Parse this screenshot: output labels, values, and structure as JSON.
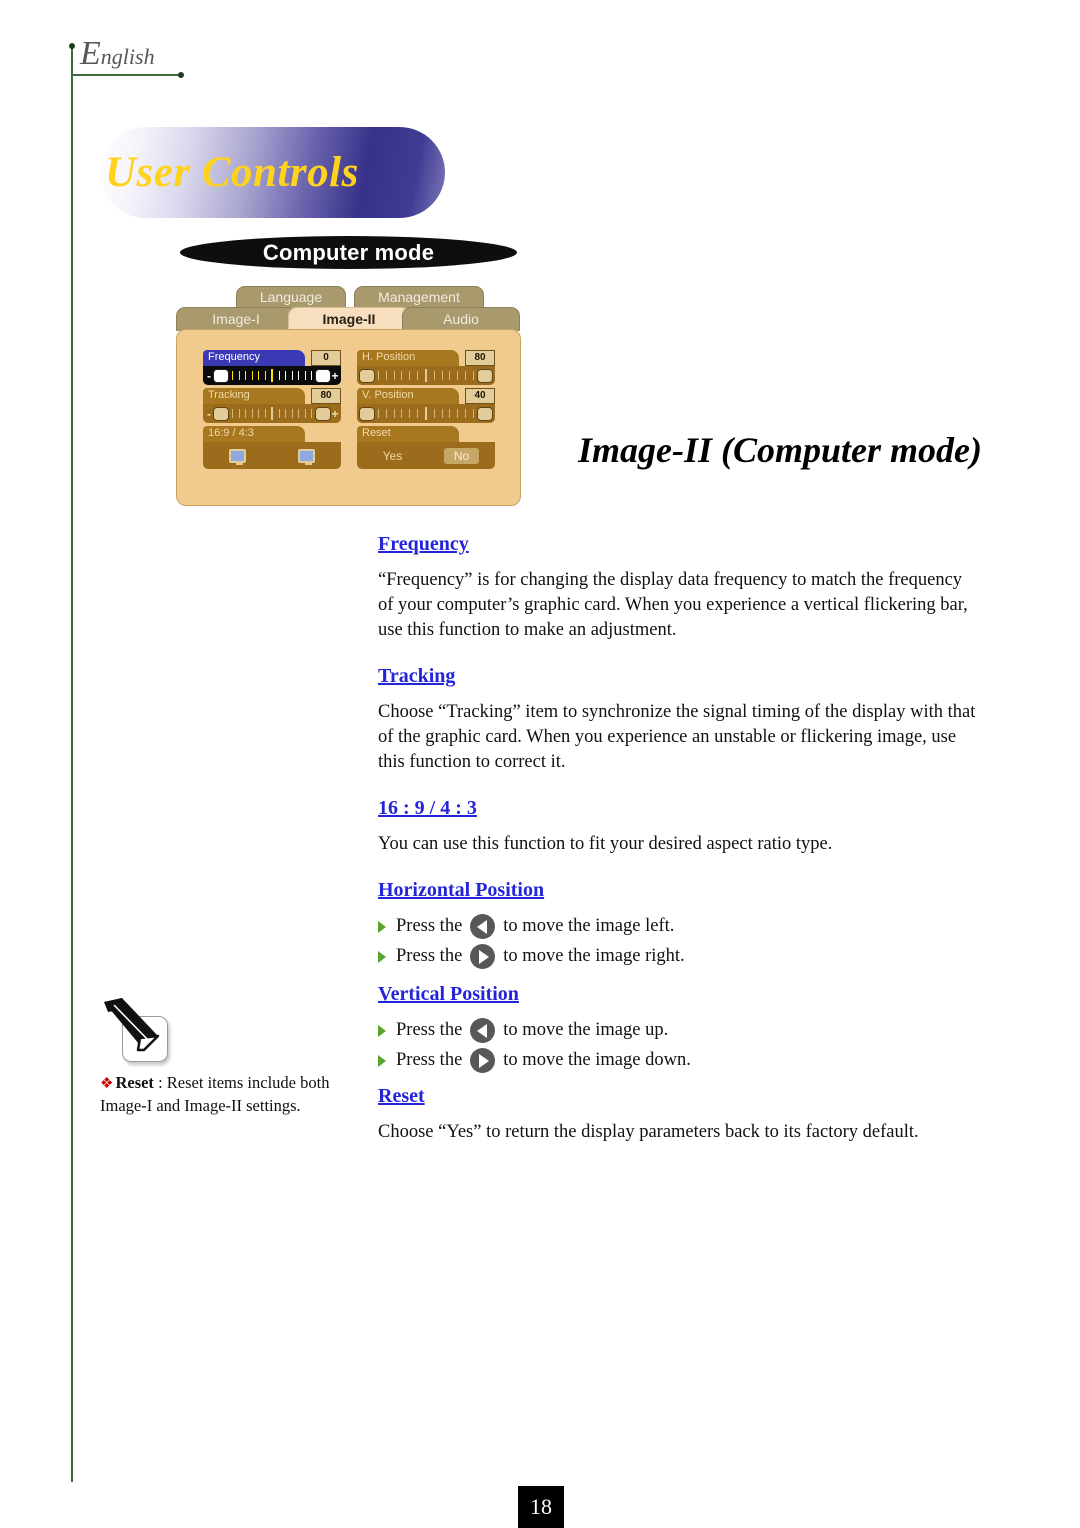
{
  "page": {
    "language_label_cap": "E",
    "language_label_rest": "nglish",
    "banner_title": "User Controls",
    "section_badge": "Computer mode",
    "heading": "Image-II (Computer mode)",
    "page_number": "18"
  },
  "osd": {
    "tabs_top": [
      {
        "label": "Language",
        "active": false
      },
      {
        "label": "Management",
        "active": false
      }
    ],
    "tabs_bottom": [
      {
        "label": "Image-I",
        "active": false
      },
      {
        "label": "Image-II",
        "active": true
      },
      {
        "label": "Audio",
        "active": false
      }
    ],
    "items": {
      "frequency": {
        "label": "Frequency",
        "value": "0",
        "minus": "-",
        "plus": "+",
        "selected": true
      },
      "tracking": {
        "label": "Tracking",
        "value": "80",
        "minus": "-",
        "plus": "+",
        "selected": false
      },
      "aspect": {
        "label": "16:9 / 4:3"
      },
      "h_position": {
        "label": "H. Position",
        "value": "80",
        "selected": false
      },
      "v_position": {
        "label": "V. Position",
        "value": "40",
        "selected": false
      },
      "reset": {
        "label": "Reset",
        "yes": "Yes",
        "no": "No",
        "selected_option": "No"
      }
    }
  },
  "sections": [
    {
      "title": "Frequency",
      "body": "“Frequency” is for changing the display data frequency to match the frequency of your computer’s graphic card. When you experience a vertical flickering bar, use this function to make an adjustment."
    },
    {
      "title": "Tracking",
      "body": "Choose “Tracking” item to synchronize the signal timing of the display with that of the graphic card. When you experience an unstable or flickering image, use this function to correct it."
    },
    {
      "title": "16 : 9 / 4 : 3",
      "body": "You can use this function to fit your desired aspect ratio type."
    },
    {
      "title": "Horizontal Position",
      "bullets": [
        {
          "press": "Press the",
          "icon": "arrow-left-icon",
          "tail": "to move the image left."
        },
        {
          "press": "Press the",
          "icon": "arrow-right-icon",
          "tail": "to move the image right."
        }
      ]
    },
    {
      "title": "Vertical Position",
      "bullets": [
        {
          "press": "Press the",
          "icon": "arrow-left-icon",
          "tail": "to move the image up."
        },
        {
          "press": "Press the",
          "icon": "arrow-right-icon",
          "tail": "to move the image down."
        }
      ]
    },
    {
      "title": "Reset",
      "body": "Choose “Yes” to return the display parameters back to its factory default."
    }
  ],
  "note": {
    "bullet": "❖",
    "term": "Reset",
    "separator": " : ",
    "text": "Reset items include both Image-I and Image-II settings."
  },
  "colors": {
    "rule_green": "#3e6b3e",
    "heading_blue": "#2424d8",
    "banner_gold": "#ffd21e",
    "osd_body": "#f0cb8d",
    "osd_tab": "#a99a6e",
    "osd_active_tab": "#f6debf",
    "osd_bar": "#9a6c1c",
    "osd_header": "#a87820",
    "osd_selected_header": "#3a3ab5",
    "bullet_green": "#5aa32f",
    "note_red": "#cc0000",
    "arrow_button_gray": "#58585a"
  }
}
